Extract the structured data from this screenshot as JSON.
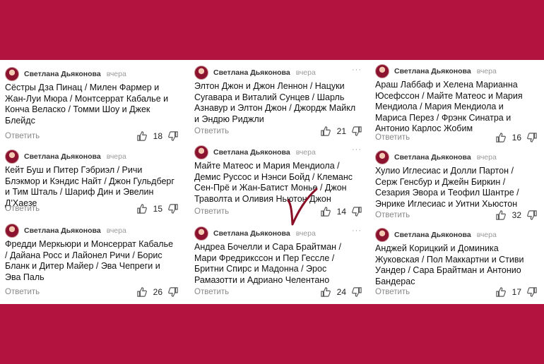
{
  "author": "Светлана Дьяконова",
  "time": "вчера",
  "reply_label": "Ответить",
  "columns": [
    [
      {
        "text": "Сёстры Дза Пинац / Милен Фармер и Жан-Луи Мюра / Монтсеррат Кабалье и Конча Веласко / Томми Шоу и Джек Блейдс",
        "likes": "18"
      },
      {
        "text": "Кейт Буш и Питер Гэбриэл / Ричи Блэкмор и Кэндис Найт / Джон Гульдберг и Тим Шталь / Шариф Дин и Эвелин Д'Хаезе",
        "likes": "15"
      },
      {
        "text": "Фредди Меркьюри и Монсеррат Кабалье / Дайана Росс и Лайонел Ричи / Борис Бланк и Дитер Майер / Эва Чепреги и Эва Паль",
        "likes": "26"
      }
    ],
    [
      {
        "text": "Элтон Джон и Джон Леннон / Нацуки Сугавара и Виталий Сунцев / Шарль Азнавур и Элтон Джон / Джордж Майкл и Эндрю Риджли",
        "likes": "21"
      },
      {
        "text": "Майте Матеос и Мария Мендиола / Демис Руссос и Нэнси Бойд / Клеманс Сен-Прё и Жан-Батист Монье / Джон Траволта и Оливия Ньютон Джон",
        "likes": "14"
      },
      {
        "text": "Андреа Бочелли и Сара Брайтман / Мари Фредрикссон и Пер Гессле / Бритни Спирс и Мадонна / Эрос Рамазотти и Адриано Челентано",
        "likes": "24"
      }
    ],
    [
      {
        "text": "Араш Лаббаф и Хелена Марианна Юсефссон / Майте Матеос и Мария Мендиола / Мария Мендиола и Мариса Перез / Фрэнк Синатра и Антонио Карлос Жобим",
        "likes": "16"
      },
      {
        "text": "Хулио Иглесиас и Долли Партон / Серж Генсбур и Джейн Биркин / Сезария Эвора и Теофил Шантре / Энрике Иглесиас и Уитни Хьюстон",
        "likes": "32"
      },
      {
        "text": "Анджей Корицкий и Доминика Жуковская / Пол Маккартни и Стиви Уандер / Сара Брайтман и Антонио Бандерас",
        "likes": "17"
      }
    ]
  ]
}
